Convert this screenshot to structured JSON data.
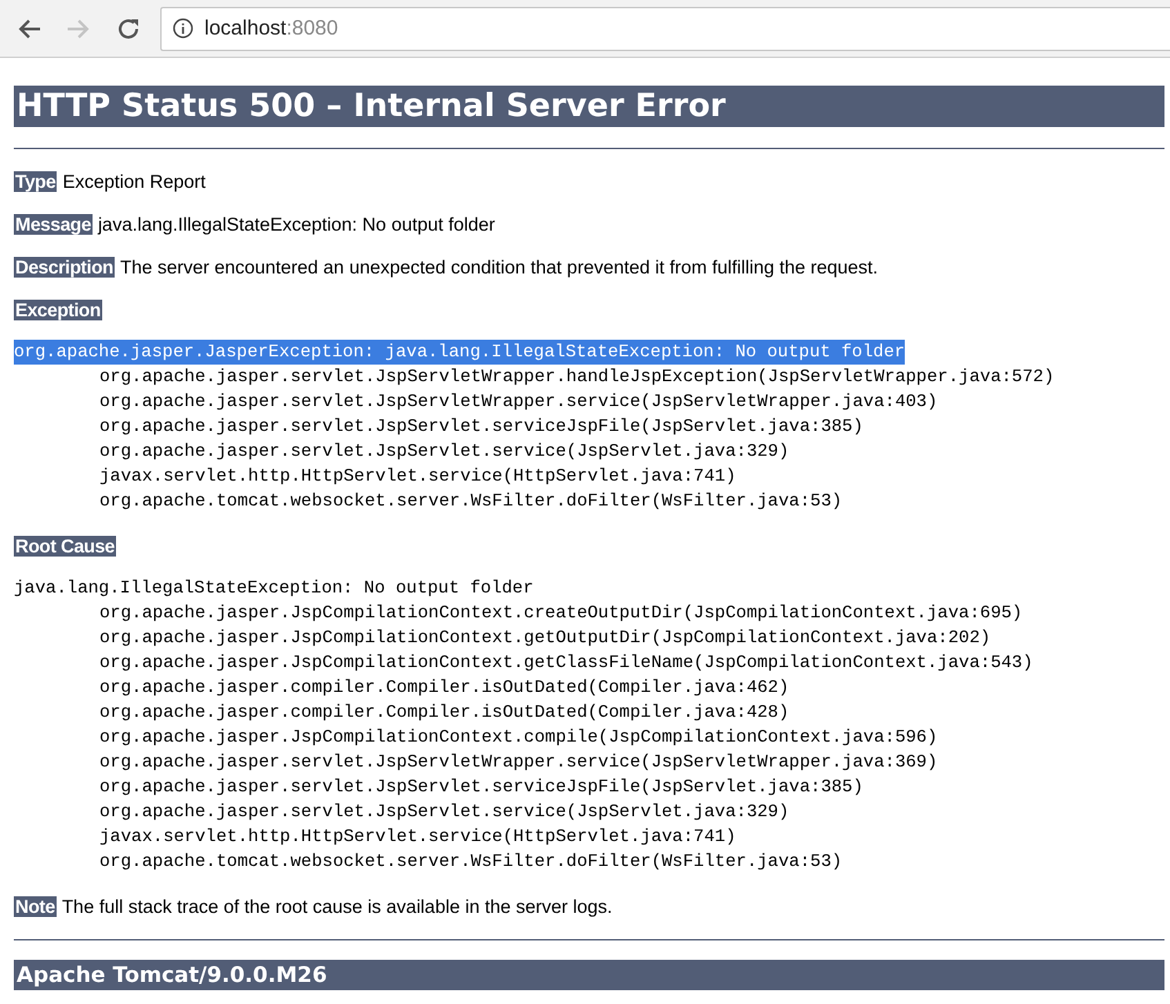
{
  "browser": {
    "address_host": "localhost",
    "address_port": ":8080"
  },
  "title": "HTTP Status 500 – Internal Server Error",
  "fields": [
    {
      "label": "Type",
      "text": "Exception Report"
    },
    {
      "label": "Message",
      "text": "java.lang.IllegalStateException: No output folder"
    },
    {
      "label": "Description",
      "text": "The server encountered an unexpected condition that prevented it from fulfilling the request."
    }
  ],
  "exception": {
    "label": "Exception",
    "first_line": "org.apache.jasper.JasperException: java.lang.IllegalStateException: No output folder",
    "selected": true,
    "frames": [
      "org.apache.jasper.servlet.JspServletWrapper.handleJspException(JspServletWrapper.java:572)",
      "org.apache.jasper.servlet.JspServletWrapper.service(JspServletWrapper.java:403)",
      "org.apache.jasper.servlet.JspServlet.serviceJspFile(JspServlet.java:385)",
      "org.apache.jasper.servlet.JspServlet.service(JspServlet.java:329)",
      "javax.servlet.http.HttpServlet.service(HttpServlet.java:741)",
      "org.apache.tomcat.websocket.server.WsFilter.doFilter(WsFilter.java:53)"
    ]
  },
  "root_cause": {
    "label": "Root Cause",
    "first_line": "java.lang.IllegalStateException: No output folder",
    "selected": false,
    "frames": [
      "org.apache.jasper.JspCompilationContext.createOutputDir(JspCompilationContext.java:695)",
      "org.apache.jasper.JspCompilationContext.getOutputDir(JspCompilationContext.java:202)",
      "org.apache.jasper.JspCompilationContext.getClassFileName(JspCompilationContext.java:543)",
      "org.apache.jasper.compiler.Compiler.isOutDated(Compiler.java:462)",
      "org.apache.jasper.compiler.Compiler.isOutDated(Compiler.java:428)",
      "org.apache.jasper.JspCompilationContext.compile(JspCompilationContext.java:596)",
      "org.apache.jasper.servlet.JspServletWrapper.service(JspServletWrapper.java:369)",
      "org.apache.jasper.servlet.JspServlet.serviceJspFile(JspServlet.java:385)",
      "org.apache.jasper.servlet.JspServlet.service(JspServlet.java:329)",
      "javax.servlet.http.HttpServlet.service(HttpServlet.java:741)",
      "org.apache.tomcat.websocket.server.WsFilter.doFilter(WsFilter.java:53)"
    ]
  },
  "note": {
    "label": "Note",
    "text": "The full stack trace of the root cause is available in the server logs."
  },
  "footer": "Apache Tomcat/9.0.0.M26"
}
